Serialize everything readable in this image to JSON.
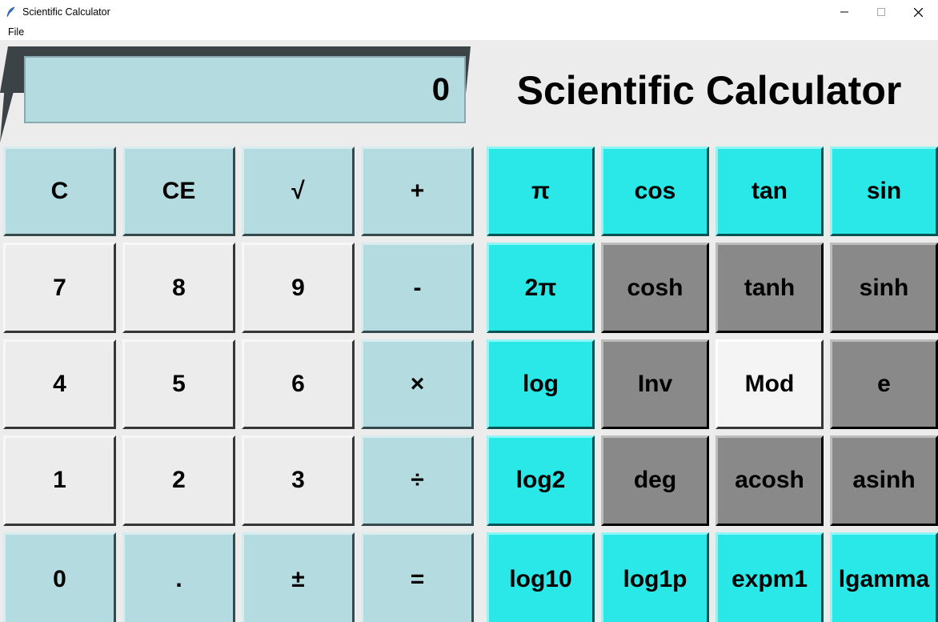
{
  "window": {
    "title": "Scientific Calculator"
  },
  "menu": {
    "file": "File"
  },
  "display": {
    "value": "0"
  },
  "heading": "Scientific Calculator",
  "left_buttons": {
    "r0": {
      "c0": "C",
      "c1": "CE",
      "c2": "√",
      "c3": "+"
    },
    "r1": {
      "c0": "7",
      "c1": "8",
      "c2": "9",
      "c3": "-"
    },
    "r2": {
      "c0": "4",
      "c1": "5",
      "c2": "6",
      "c3": "×"
    },
    "r3": {
      "c0": "1",
      "c1": "2",
      "c2": "3",
      "c3": "÷"
    },
    "r4": {
      "c0": "0",
      "c1": ".",
      "c2": "±",
      "c3": "="
    }
  },
  "right_buttons": {
    "r0": {
      "c0": "π",
      "c1": "cos",
      "c2": "tan",
      "c3": "sin"
    },
    "r1": {
      "c0": "2π",
      "c1": "cosh",
      "c2": "tanh",
      "c3": "sinh"
    },
    "r2": {
      "c0": "log",
      "c1": "Inv",
      "c2": "Mod",
      "c3": "e"
    },
    "r3": {
      "c0": "log2",
      "c1": "deg",
      "c2": "acosh",
      "c3": "asinh"
    },
    "r4": {
      "c0": "log10",
      "c1": "log1p",
      "c2": "expm1",
      "c3": "lgamma"
    }
  }
}
